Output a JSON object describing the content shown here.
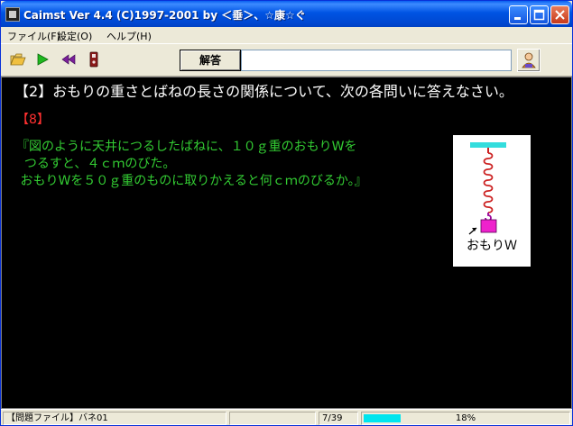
{
  "window": {
    "title": "Caimst Ver 4.4 (C)1997-2001  by ＜垂＞、☆康☆ぐ"
  },
  "menu": {
    "items": [
      "ファイル(F)",
      "設定(O)",
      "ヘルプ(H)"
    ]
  },
  "toolbar": {
    "answer_label": "解答",
    "answer_value": "",
    "icons": [
      "folder-open-icon",
      "play-icon",
      "rewind-icon",
      "control-icon",
      "person-icon"
    ]
  },
  "question": {
    "title": "【2】おもりの重さとばねの長さの関係について、次の各問いに答えなさい。",
    "number": "【8】",
    "lines": [
      "『図のように天井につるしたばねに、１０ｇ重のおもりWを",
      "  つるすと、４ｃｍのびた。",
      " おもりWを５０ｇ重のものに取りかえると何ｃｍのびるか。』"
    ],
    "figure_label": "おもりＷ"
  },
  "status": {
    "file": "【問題ファイル】バネ01",
    "blank": "",
    "count": "7/39",
    "progress_text": "18%",
    "progress_value": 0.18
  },
  "colors": {
    "question_title": "#FFFFFF",
    "question_number": "#FF3030",
    "question_body": "#33CC33",
    "ceiling": "#33DDDD",
    "spring": "#CC2222",
    "weight": "#EE22CC",
    "progress": "#00E5EE"
  }
}
